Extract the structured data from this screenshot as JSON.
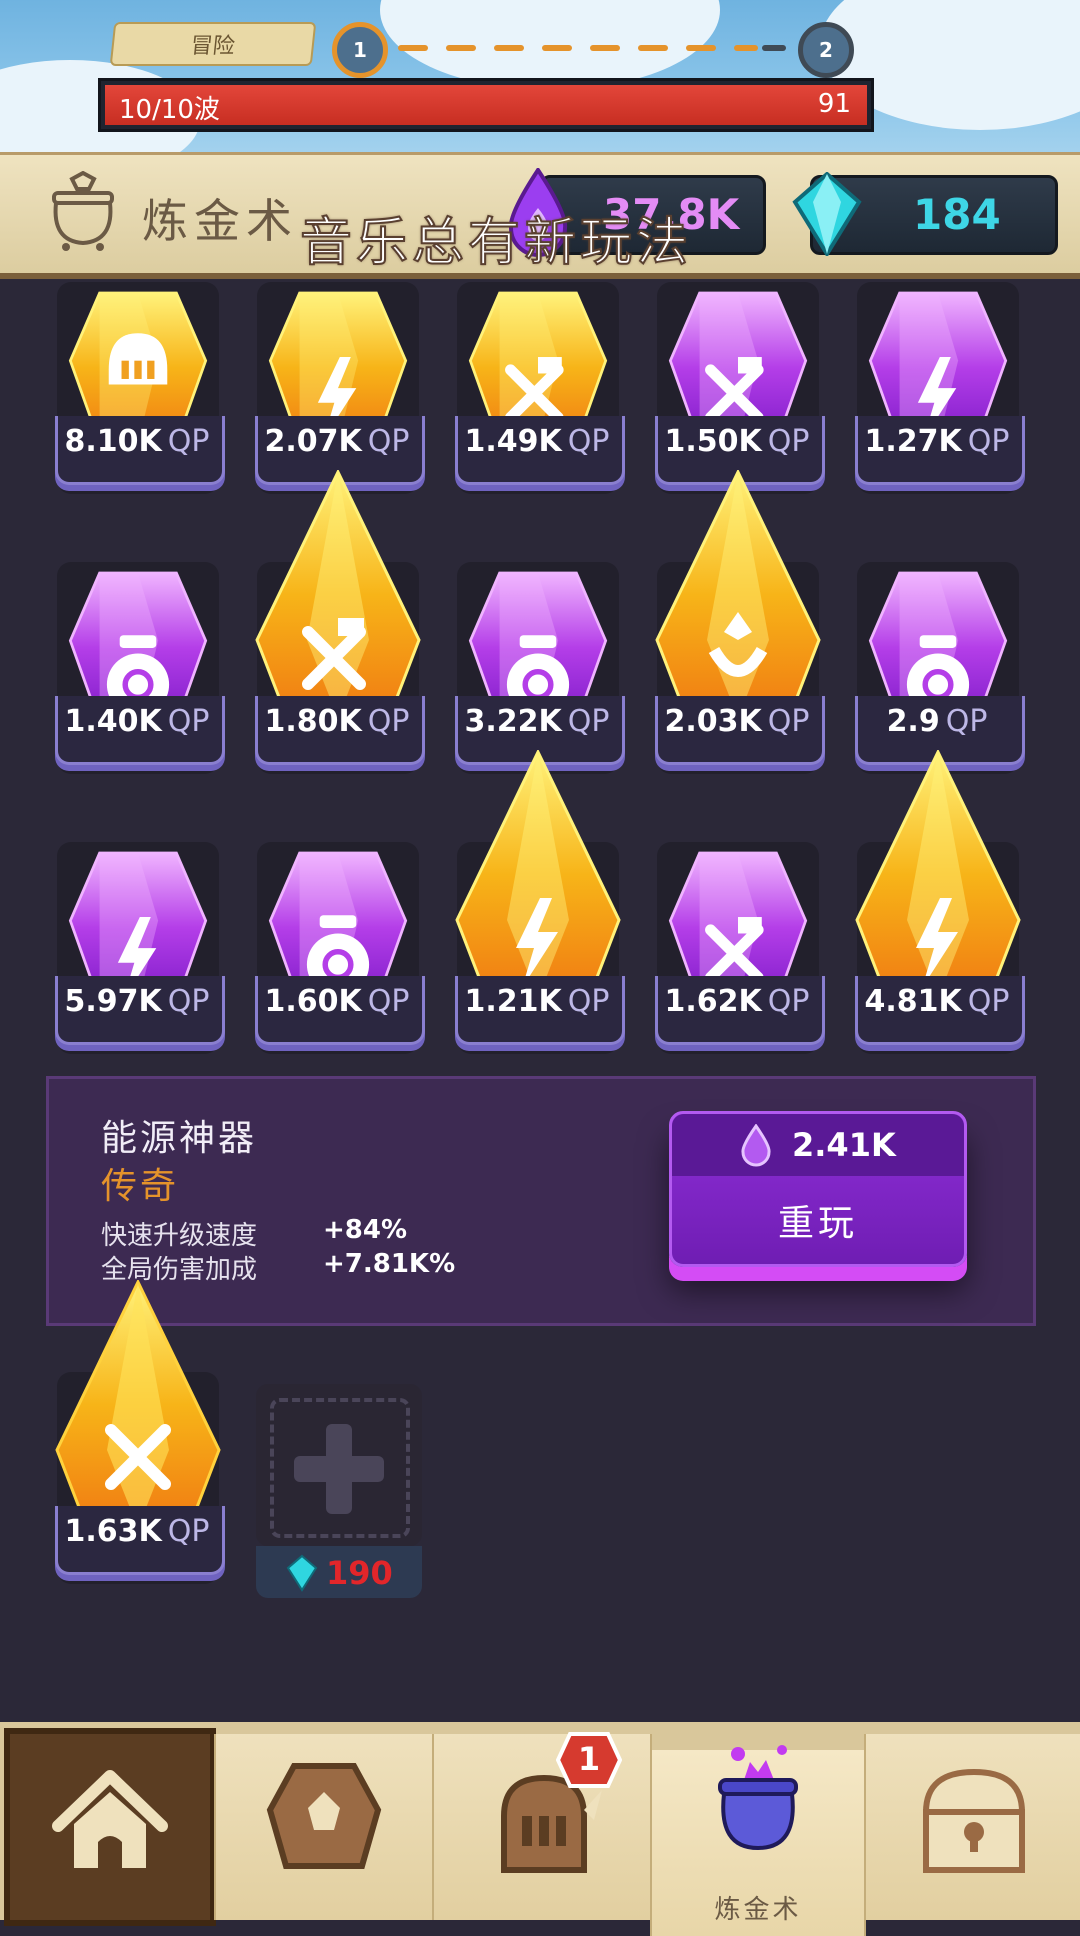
{
  "stage": {
    "label": "冒险",
    "node_current": "1",
    "node_next": "2"
  },
  "wave": {
    "text": "10/10波",
    "value": "91",
    "fill": 1.0
  },
  "header": {
    "title": "炼金术",
    "overlay": "音乐总有新玩法",
    "qp": "37.8K",
    "gems": "184"
  },
  "grid": {
    "unit": "QP",
    "slots": [
      {
        "value": "8.10K",
        "color": "gold",
        "icon": "helmet-icon"
      },
      {
        "value": "2.07K",
        "color": "gold",
        "icon": "lightning-icon"
      },
      {
        "value": "1.49K",
        "color": "gold",
        "icon": "hammer-icon"
      },
      {
        "value": "1.50K",
        "color": "purple",
        "icon": "hammer-icon"
      },
      {
        "value": "1.27K",
        "color": "purple",
        "icon": "lightning-icon"
      },
      {
        "value": "1.40K",
        "color": "purple",
        "icon": "money-bag-icon"
      },
      {
        "value": "1.80K",
        "color": "gold",
        "icon": "hammer-icon"
      },
      {
        "value": "3.22K",
        "color": "purple",
        "icon": "money-bag-icon"
      },
      {
        "value": "2.03K",
        "color": "gold",
        "icon": "horn-icon"
      },
      {
        "value": "2.9",
        "color": "purple",
        "icon": "money-bag-icon"
      },
      {
        "value": "5.97K",
        "color": "purple",
        "icon": "lightning-icon"
      },
      {
        "value": "1.60K",
        "color": "purple",
        "icon": "money-bag-icon"
      },
      {
        "value": "1.21K",
        "color": "gold",
        "icon": "lightning-icon"
      },
      {
        "value": "1.62K",
        "color": "purple",
        "icon": "hammer-icon"
      },
      {
        "value": "4.81K",
        "color": "gold",
        "icon": "lightning-icon"
      }
    ]
  },
  "detail": {
    "name": "能源神器",
    "rarity": "传奇",
    "stats": [
      {
        "label": "快速升级速度",
        "value": "+84%"
      },
      {
        "label": "全局伤害加成",
        "value": "+7.81K%"
      }
    ],
    "reroll_cost": "2.41K",
    "reroll_label": "重玩"
  },
  "equipped": {
    "value": "1.63K",
    "unit": "QP",
    "icon": "hammer-icon"
  },
  "add_slot": {
    "cost": "190"
  },
  "nav": {
    "badge": "1",
    "active_label": "炼金术"
  },
  "colors": {
    "gold": "#f7b418",
    "purple": "#b43ee8",
    "accent": "#e5932b",
    "red": "#d63a2f"
  }
}
